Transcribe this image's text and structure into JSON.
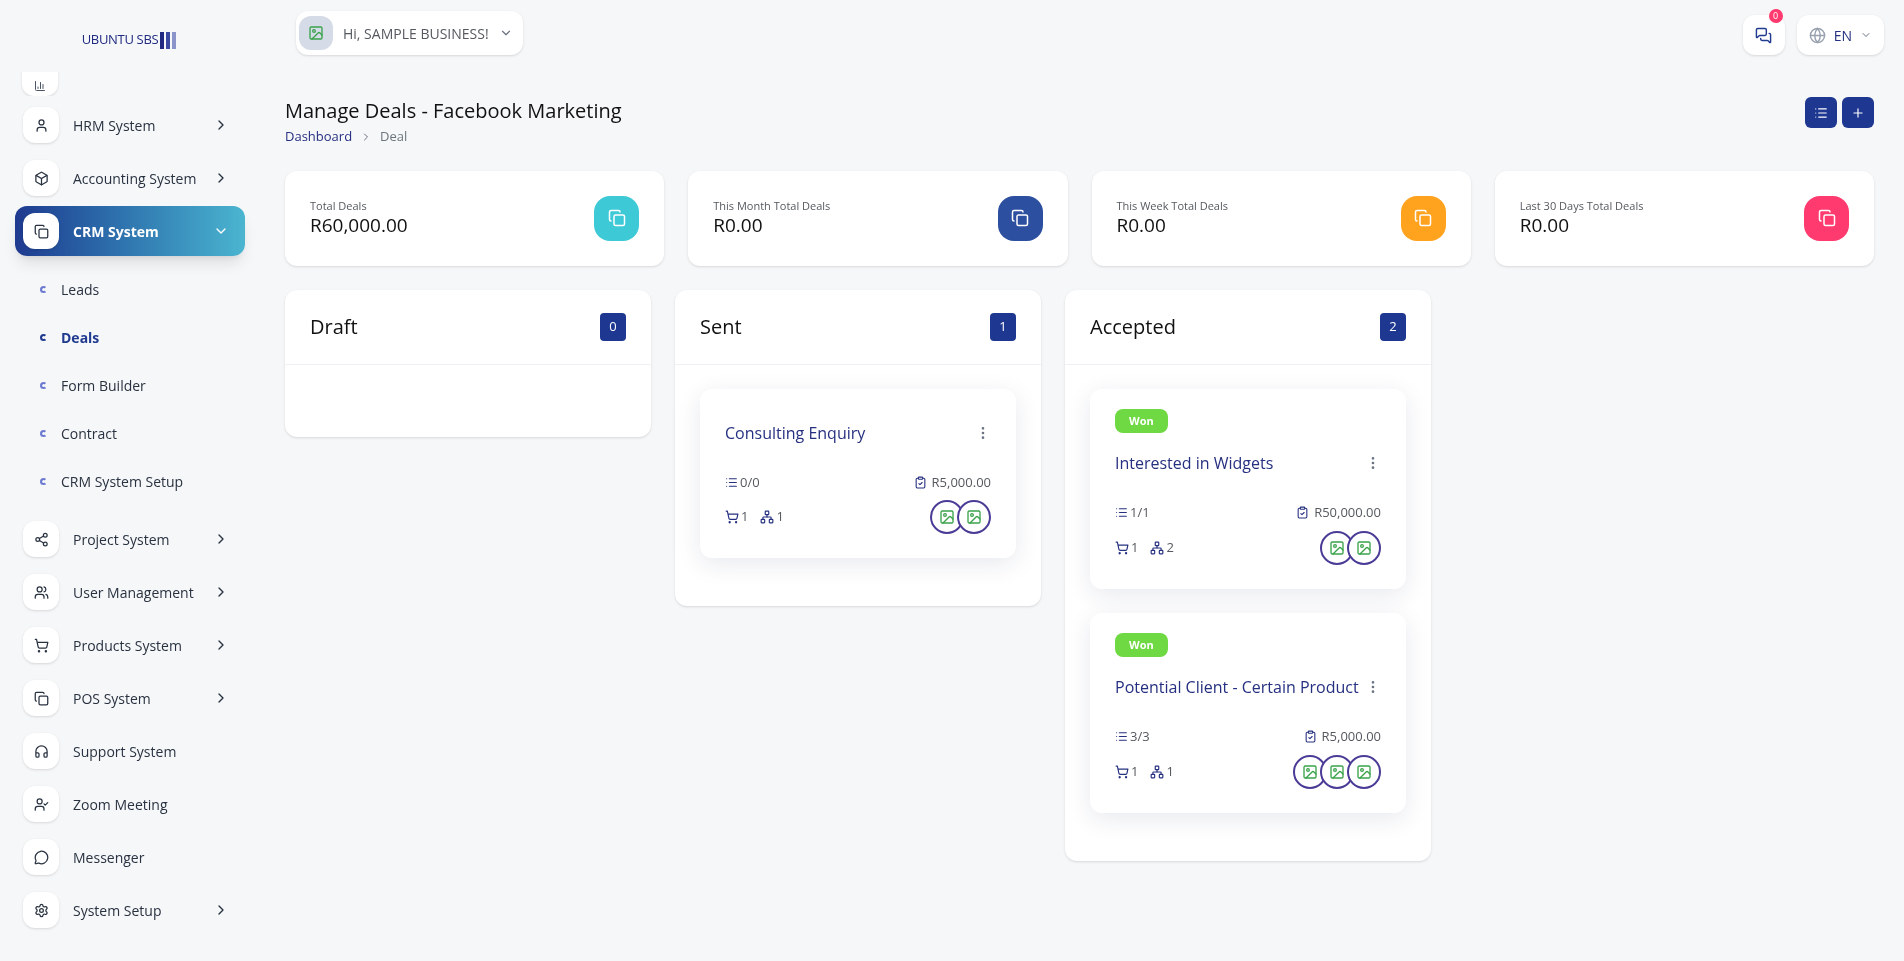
{
  "logo": {
    "text": "UBUNTU SBS"
  },
  "header": {
    "greeting": "Hi, SAMPLE BUSINESS!",
    "notifications": "0",
    "language": "EN"
  },
  "sidebar": {
    "items": [
      {
        "kind": "partial"
      },
      {
        "kind": "menu",
        "label": "HRM System",
        "selected": false,
        "expanded": false
      },
      {
        "kind": "menu",
        "label": "Accounting System",
        "selected": false,
        "expanded": false
      },
      {
        "kind": "menu",
        "label": "CRM System",
        "selected": true,
        "expanded": true,
        "children": [
          {
            "label": "Leads",
            "selected": false
          },
          {
            "label": "Deals",
            "selected": true
          },
          {
            "label": "Form Builder",
            "selected": false
          },
          {
            "label": "Contract",
            "selected": false
          },
          {
            "label": "CRM System Setup",
            "selected": false
          }
        ]
      },
      {
        "kind": "menu",
        "label": "Project System",
        "selected": false,
        "expanded": false
      },
      {
        "kind": "menu",
        "label": "User Management",
        "selected": false,
        "expanded": false
      },
      {
        "kind": "menu",
        "label": "Products System",
        "selected": false,
        "expanded": false
      },
      {
        "kind": "menu",
        "label": "POS System",
        "selected": false,
        "expanded": false
      },
      {
        "kind": "menu",
        "label": "Support System",
        "selected": false
      },
      {
        "kind": "menu",
        "label": "Zoom Meeting",
        "selected": false
      },
      {
        "kind": "menu",
        "label": "Messenger",
        "selected": false
      },
      {
        "kind": "menu",
        "label": "System Setup",
        "selected": false,
        "expanded": false
      }
    ]
  },
  "page": {
    "title": "Manage Deals - Facebook Marketing",
    "breadcrumb": [
      "Dashboard",
      "Deal"
    ]
  },
  "stats": [
    {
      "label": "Total Deals",
      "value": "R60,000.00",
      "color": "#3ec9d6"
    },
    {
      "label": "This Month Total Deals",
      "value": "R0.00",
      "color": "#2c4fa0"
    },
    {
      "label": "This Week Total Deals",
      "value": "R0.00",
      "color": "#ffa21d"
    },
    {
      "label": "Last 30 Days Total Deals",
      "value": "R0.00",
      "color": "#ff3a6e"
    }
  ],
  "stages": [
    {
      "name": "Draft",
      "count": "0"
    },
    {
      "name": "Sent",
      "count": "1",
      "deals": [
        {
          "title": "Consulting Enquiry",
          "tasks": "0/0",
          "price": "R5,000.00",
          "products": "1",
          "sources": "1",
          "avatars": [
            {
              "broken_image": true
            },
            {
              "broken_image": true
            }
          ]
        }
      ]
    },
    {
      "name": "Accepted",
      "count": "2",
      "deals": [
        {
          "status": "Won",
          "title": "Interested in Widgets",
          "tasks": "1/1",
          "price": "R50,000.00",
          "products": "1",
          "sources": "2",
          "avatars": [
            {
              "broken_image": true
            },
            {
              "broken_image": true
            }
          ]
        },
        {
          "status": "Won",
          "title": "Potential Client - Certain Product",
          "tasks": "3/3",
          "price": "R5,000.00",
          "products": "1",
          "sources": "1",
          "avatars": [
            {
              "broken_image": true
            },
            {
              "broken_image": true
            },
            {
              "broken_image": true
            }
          ]
        }
      ]
    }
  ]
}
